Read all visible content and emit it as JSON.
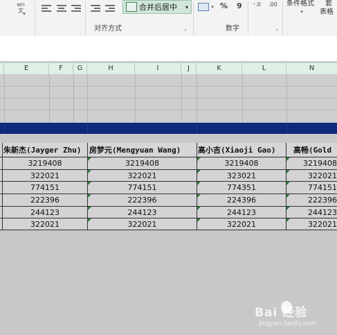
{
  "ribbon": {
    "wrap_text_label": "wn\n文",
    "merge_center_label": "合并后居中",
    "alignment_group_label": "对齐方式",
    "number_group_label": "数字",
    "percent_symbol": "%",
    "comma_symbol": "9",
    "conditional_format_label": "条件格式",
    "table_format_label": "表格",
    "increase_decimal_label": "⁺.0",
    "decrease_decimal_label": ".00",
    "dropdown_arrow": "▾",
    "launcher_glyph": "⌟",
    "top_right_glyph": "套"
  },
  "columns": [
    "E",
    "F",
    "G",
    "H",
    "I",
    "J",
    "K",
    "L",
    "N"
  ],
  "table": {
    "headers": [
      "朱新杰(Jayger Zhu)",
      "房梦元(Mengyuan Wang)",
      "高小吉(Xiaoji Gao)",
      "高畅(Gold"
    ],
    "rows": [
      [
        "3219408",
        "3219408",
        "3219408",
        "3219408"
      ],
      [
        "322021",
        "322021",
        "323021",
        "322021"
      ],
      [
        "774151",
        "774151",
        "774351",
        "774151"
      ],
      [
        "222396",
        "222396",
        "224396",
        "222396"
      ],
      [
        "244123",
        "244123",
        "244123",
        "244123"
      ],
      [
        "322021",
        "322021",
        "322021",
        "322021"
      ]
    ]
  },
  "watermark": {
    "brand": "Bai 经验",
    "url": "jingyan.baidu.com"
  },
  "colors": {
    "selected_row": "#0d2a7a",
    "column_header_bg": "#dff0e6",
    "merge_button_bg": "#cfe6d8",
    "grid_bg": "#c9c7c9"
  }
}
